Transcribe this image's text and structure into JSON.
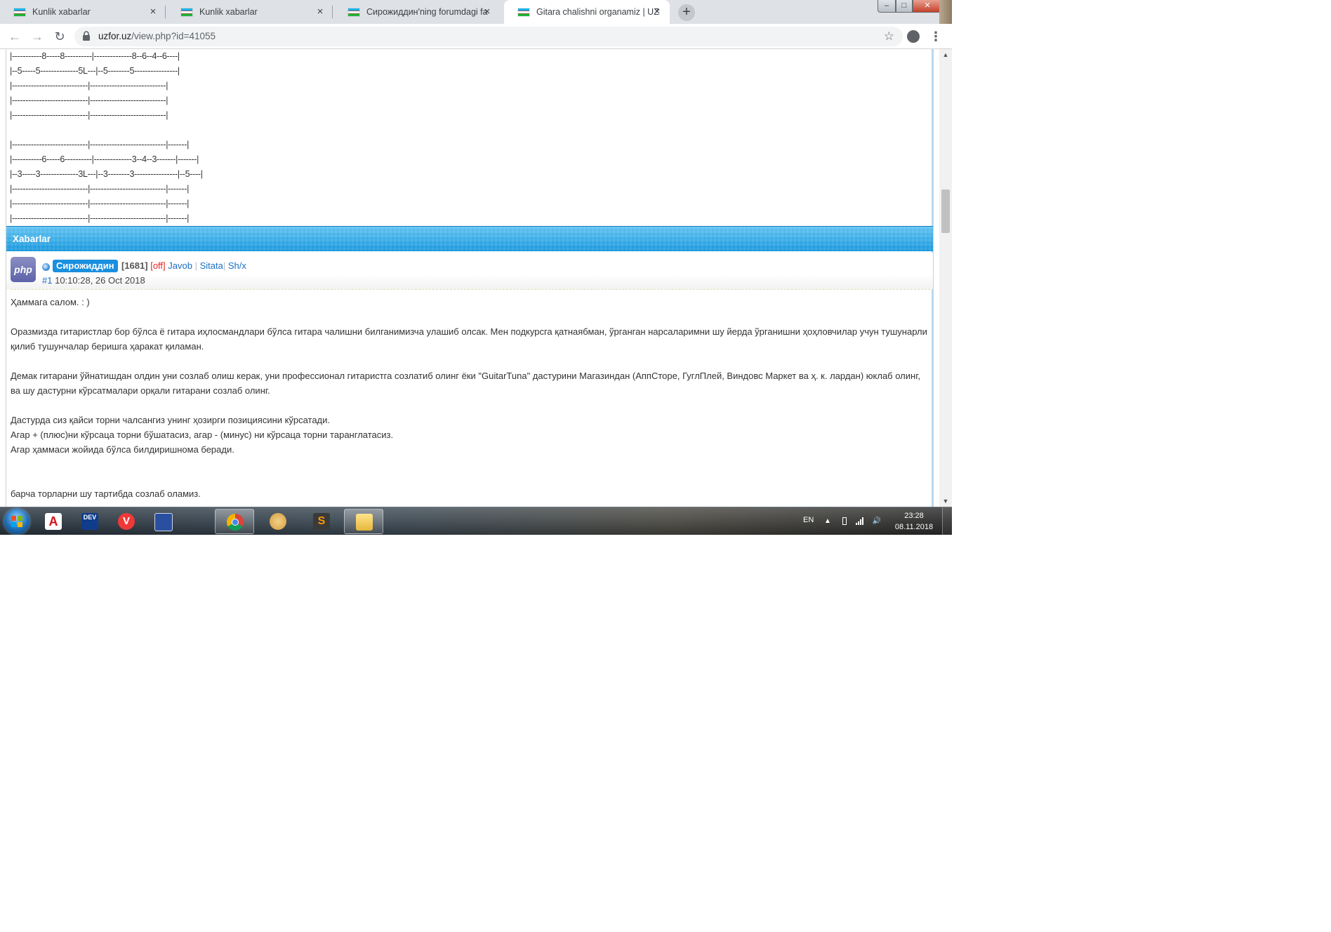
{
  "browser": {
    "tabs": [
      {
        "title": "Kunlik xabarlar",
        "active": false
      },
      {
        "title": "Kunlik xabarlar",
        "active": false
      },
      {
        "title": "Сирожиддин'ning forumdagi fa",
        "active": false
      },
      {
        "title": "Gitara chalishni organamiz | UZFO",
        "active": true
      }
    ],
    "close_glyph": "×",
    "new_tab_glyph": "+",
    "url_host": "uzfor.uz",
    "url_path": "/view.php?id=41055",
    "icons": {
      "back": "back-arrow-icon",
      "forward": "forward-arrow-icon",
      "reload": "reload-icon",
      "lock": "lock-icon",
      "star": "star-icon",
      "profile": "profile-icon",
      "menu": "kebab-menu-icon"
    }
  },
  "tablature": [
    "|-----------8-----8----------|--------------8--6--4--6----|",
    "|--5-----5--------------5L---|--5--------5----------------|",
    "|----------------------------|----------------------------|",
    "|----------------------------|----------------------------|",
    "|----------------------------|----------------------------|",
    "",
    "|----------------------------|----------------------------|-------|",
    "|-----------6-----6----------|--------------3--4--3-------|-------|",
    "|--3-----3--------------3L---|--3--------3----------------|--5----|",
    "|----------------------------|----------------------------|-------|",
    "|----------------------------|----------------------------|-------|",
    "|----------------------------|----------------------------|-------|"
  ],
  "section": {
    "title": "Xabarlar",
    "accent": "#1a9be0"
  },
  "post": {
    "avatar_text": "php",
    "username": "Сирожиддин",
    "count": "[1681]",
    "status": "[off]",
    "links": [
      "Javob",
      "Sitata",
      "Sh/x"
    ],
    "number": "#1",
    "datetime": "10:10:28, 26 Oct 2018",
    "paragraphs": [
      "Ҳаммага салом. : )",
      "Оразмизда гитаристлар бор бўлса ё гитара иҳлосмандлари бўлса гитара чалишни билганимизча улашиб олсак. Мен подкурсга қатнаябман, ўрганган нарсаларимни шу йерда ўрганишни ҳоҳловчилар учун тушунарли қилиб тушунчалар беришга ҳаракат қиламан.",
      "Демак гитарани ўйнатишдан олдин уни созлаб олиш керак, уни профессионал гитаристга созлатиб олинг ёки \"GuitarTuna\" дастурини Магазиндан (АппСторе, ГуглПлей, Виндовс Маркет ва ҳ. к. лардан) юклаб олинг, ва шу дастурни кўрсатмалари орқали гитарани созлаб олинг.",
      "Дастурда сиз қайси торни чалсангиз унинг ҳозирги позициясини кўрсатади.",
      "Агар + (плюс)ни кўрсаца торни бўшатасиз, агар - (минус) ни кўрсаца торни таранглатасиз.",
      "Агар ҳаммаси жойида бўлса билдиришнома беради.",
      "барча торларни шу тартибда созлаб оламиз."
    ]
  },
  "taskbar": {
    "apps": [
      "acrobat-icon",
      "devcpp-icon",
      "vivaldi-icon",
      "floppy-save-icon",
      "chrome-icon",
      "paint-icon",
      "sublime-icon",
      "explorer-folder-icon"
    ],
    "devcpp_label": "DEV",
    "acrobat_label": "A",
    "vivaldi_label": "V",
    "sublime_label": "S",
    "language": "EN",
    "time": "23:28",
    "date": "08.11.2018"
  },
  "window_controls": {
    "minimize": "–",
    "maximize": "□",
    "close": "✕"
  }
}
